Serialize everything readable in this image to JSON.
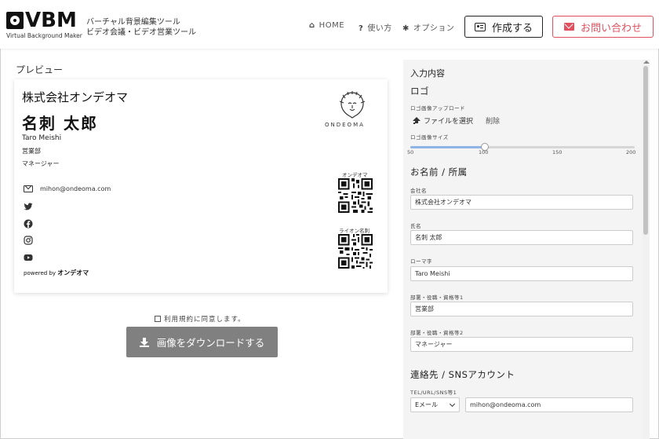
{
  "header": {
    "logo_text": "VBM",
    "logo_sub": "Virtual Background Maker",
    "tagline_1": "バーチャル背景編集ツール",
    "tagline_2": "ビデオ会議・ビデオ営業ツール",
    "nav_home": "HOME",
    "nav_usage": "使い方",
    "nav_options": "オプション",
    "create_label": "作成する",
    "contact_label": "お問い合わせ"
  },
  "preview": {
    "label": "プレビュー",
    "company": "株式会社オンデオマ",
    "name": "名刺 太郎",
    "roman": "Taro Meishi",
    "dept": "営業部",
    "title": "マネージャー",
    "email": "mihon@ondeoma.com",
    "brand": "ONDEOMA",
    "qr1_label": "オンデオマ",
    "qr2_label": "ライオン名刺",
    "powered_by": "powered by",
    "powered_brand": "オンデオマ"
  },
  "actions": {
    "terms": "利用規約に同意します。",
    "download": "画像をダウンロードする"
  },
  "form": {
    "title": "入力内容",
    "logo_section": "ロゴ",
    "logo_upload_label": "ロゴ画像アップロード",
    "file_select": "ファイルを選択",
    "delete": "削除",
    "logo_size_label": "ロゴ画像サイズ",
    "slider_ticks": [
      "50",
      "100",
      "150",
      "200"
    ],
    "slider_value": 100,
    "slider_min": 50,
    "slider_max": 200,
    "name_section": "お名前 / 所属",
    "company_label": "会社名",
    "company_value": "株式会社オンデオマ",
    "name_label": "氏名",
    "name_value": "名刺 太郎",
    "roman_label": "ローマ字",
    "roman_value": "Taro Meishi",
    "role1_label": "部署・役職・資格等1",
    "role1_value": "営業部",
    "role2_label": "部署・役職・資格等2",
    "role2_value": "マネージャー",
    "contact_section": "連絡先 / SNSアカウント",
    "tel1_label": "TEL/URL/SNS等1",
    "tel1_type": "Eメール",
    "tel1_value": "mihon@ondeoma.com"
  },
  "colors": {
    "accent_red": "#e0515f",
    "download_bg": "#808080",
    "slider_fill": "#8fb4e6"
  }
}
